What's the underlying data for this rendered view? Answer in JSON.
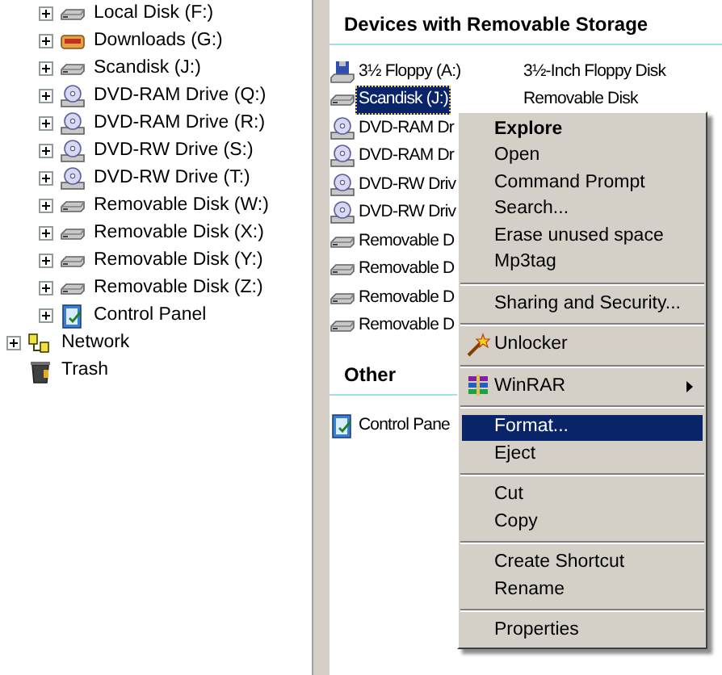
{
  "tree": {
    "nested_items": [
      {
        "label": "Local Disk (F:)",
        "kind": "drive",
        "expandable": true
      },
      {
        "label": "Downloads (G:)",
        "kind": "shared",
        "expandable": true
      },
      {
        "label": "Scandisk (J:)",
        "kind": "drive",
        "expandable": true
      },
      {
        "label": "DVD-RAM Drive (Q:)",
        "kind": "disc",
        "expandable": true
      },
      {
        "label": "DVD-RAM Drive (R:)",
        "kind": "disc",
        "expandable": true
      },
      {
        "label": "DVD-RW Drive (S:)",
        "kind": "disc",
        "expandable": true
      },
      {
        "label": "DVD-RW Drive (T:)",
        "kind": "disc",
        "expandable": true
      },
      {
        "label": "Removable Disk (W:)",
        "kind": "drive",
        "expandable": true
      },
      {
        "label": "Removable Disk (X:)",
        "kind": "drive",
        "expandable": true
      },
      {
        "label": "Removable Disk (Y:)",
        "kind": "drive",
        "expandable": true
      },
      {
        "label": "Removable Disk (Z:)",
        "kind": "drive",
        "expandable": true
      },
      {
        "label": "Control Panel",
        "kind": "panel",
        "expandable": true
      }
    ],
    "root_items": [
      {
        "label": "Network",
        "kind": "network",
        "expandable": true
      },
      {
        "label": "Trash",
        "kind": "trash",
        "expandable": false
      }
    ]
  },
  "sections": [
    {
      "title": "Devices with Removable Storage",
      "items": [
        {
          "name": "3½ Floppy (A:)",
          "type": "3½-Inch Floppy Disk",
          "kind": "floppy",
          "selected": false
        },
        {
          "name": "Scandisk (J:)",
          "type": "Removable Disk",
          "kind": "drive",
          "selected": true
        },
        {
          "name": "DVD-RAM Dr",
          "kind": "disc",
          "selected": false
        },
        {
          "name": "DVD-RAM Dr",
          "kind": "disc",
          "selected": false
        },
        {
          "name": "DVD-RW Driv",
          "kind": "disc",
          "selected": false
        },
        {
          "name": "DVD-RW Driv",
          "kind": "disc",
          "selected": false
        },
        {
          "name": "Removable D",
          "kind": "drive",
          "selected": false
        },
        {
          "name": "Removable D",
          "kind": "drive",
          "selected": false
        },
        {
          "name": "Removable D",
          "kind": "drive",
          "selected": false
        },
        {
          "name": "Removable D",
          "kind": "drive",
          "selected": false
        }
      ]
    },
    {
      "title": "Other",
      "items": [
        {
          "name": "Control Pane",
          "kind": "panel",
          "selected": false
        }
      ]
    }
  ],
  "context_menu": [
    {
      "kind": "item",
      "label": "Explore",
      "default": true,
      "selected": false
    },
    {
      "kind": "item",
      "label": "Open",
      "selected": false
    },
    {
      "kind": "item",
      "label": "Command Prompt",
      "selected": false
    },
    {
      "kind": "item",
      "label": "Search...",
      "selected": false
    },
    {
      "kind": "item",
      "label": "Erase unused space",
      "selected": false
    },
    {
      "kind": "item",
      "label": "Mp3tag",
      "selected": false
    },
    {
      "kind": "separator"
    },
    {
      "kind": "item",
      "label": "Sharing and Security...",
      "selected": false
    },
    {
      "kind": "separator"
    },
    {
      "kind": "wand",
      "label": "Unlocker",
      "selected": false
    },
    {
      "kind": "separator"
    },
    {
      "kind": "archive",
      "label": "WinRAR",
      "submenu": true,
      "selected": false
    },
    {
      "kind": "separator"
    },
    {
      "kind": "item",
      "label": "Format...",
      "selected": true
    },
    {
      "kind": "item",
      "label": "Eject",
      "selected": false
    },
    {
      "kind": "separator"
    },
    {
      "kind": "item",
      "label": "Cut",
      "selected": false
    },
    {
      "kind": "item",
      "label": "Copy",
      "selected": false
    },
    {
      "kind": "separator"
    },
    {
      "kind": "item",
      "label": "Create Shortcut",
      "selected": false
    },
    {
      "kind": "item",
      "label": "Rename",
      "selected": false
    },
    {
      "kind": "separator"
    },
    {
      "kind": "item",
      "label": "Properties",
      "selected": false
    }
  ]
}
